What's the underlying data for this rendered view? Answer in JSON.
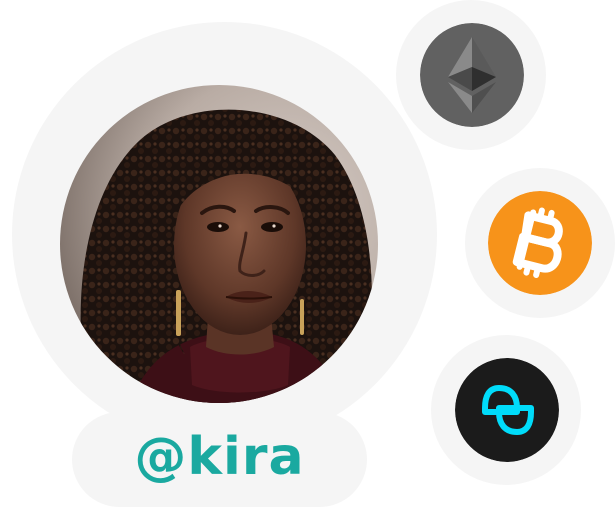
{
  "profile": {
    "handle": "@kira",
    "handle_color": "#1aa9a0"
  },
  "coins": [
    {
      "icon": "ethereum-icon",
      "color": "#616161"
    },
    {
      "icon": "bitcoin-icon",
      "color": "#f7931a"
    },
    {
      "icon": "gemini-icon",
      "color": "#1b1b1b",
      "accent": "#00dcfa"
    }
  ],
  "colors": {
    "halo": "#f5f5f5"
  }
}
